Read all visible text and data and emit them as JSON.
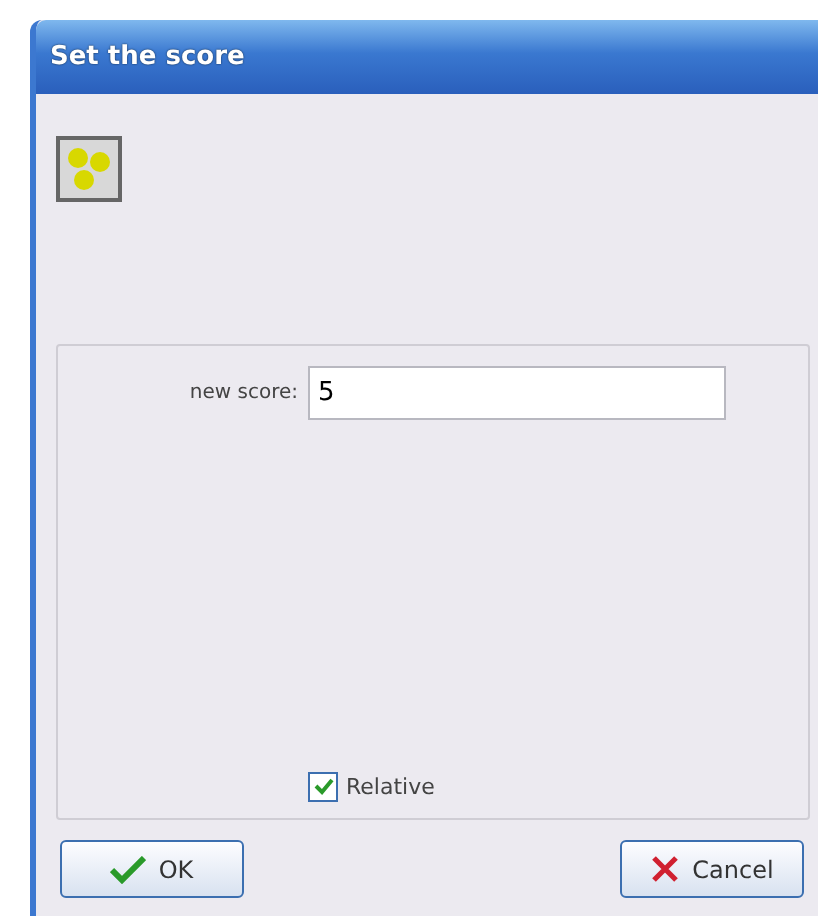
{
  "window": {
    "title": "Set the score"
  },
  "field": {
    "label": "new score:",
    "value": "5"
  },
  "checkbox": {
    "label": "Relative",
    "checked": true
  },
  "buttons": [
    {
      "kind": "ok",
      "label": "OK"
    },
    {
      "kind": "cancel",
      "label": "Cancel"
    }
  ]
}
